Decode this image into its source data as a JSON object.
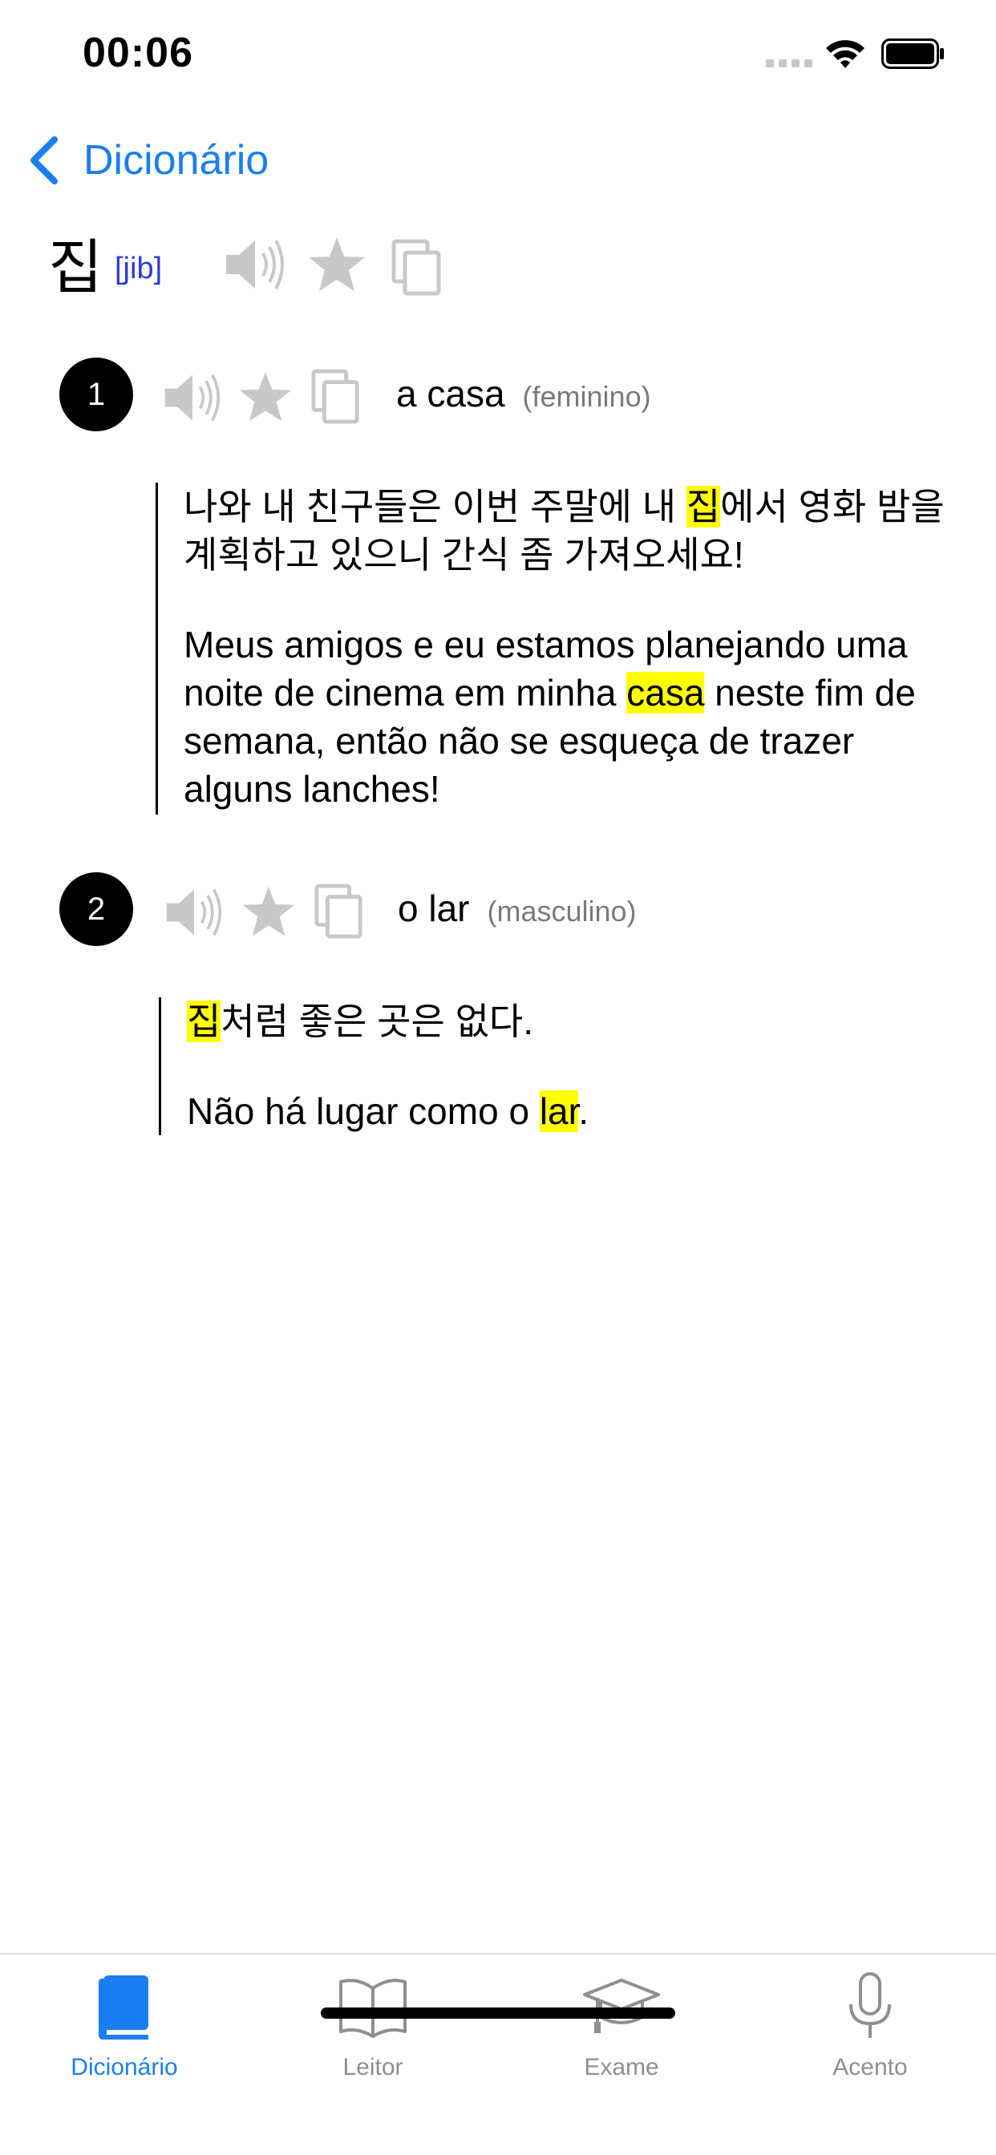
{
  "status_bar": {
    "time": "00:06",
    "wifi_icon": "wifi-icon",
    "battery_icon": "battery-icon"
  },
  "navigation": {
    "back_label": "Dicionário",
    "back_icon": "chevron-left-icon"
  },
  "entry": {
    "headword": "집",
    "romanization": "[jib]",
    "actions": [
      "speaker-icon",
      "star-icon",
      "copy-icon"
    ]
  },
  "senses": [
    {
      "number": "1",
      "translation": "a casa",
      "gender": "(feminino)",
      "example": {
        "korean": {
          "before": "나와 내 친구들은 이번 주말에 내 ",
          "highlight": "집",
          "after": "에서 영화 밤을 계획하고 있으니 간식 좀 가져오세요!"
        },
        "portuguese": {
          "before": "Meus amigos e eu estamos planejando uma noite de cinema em minha ",
          "highlight": "casa",
          "after": " neste fim de semana, então não se esqueça de trazer alguns lanches!"
        }
      }
    },
    {
      "number": "2",
      "translation": "o lar",
      "gender": "(masculino)",
      "example": {
        "korean": {
          "before": "",
          "highlight": "집",
          "after": "처럼 좋은 곳은 없다."
        },
        "portuguese": {
          "before": "Não há lugar como o ",
          "highlight": "lar",
          "after": "."
        }
      }
    }
  ],
  "tab_bar": {
    "tabs": [
      {
        "label": "Dicionário",
        "icon": "book-icon",
        "active": true
      },
      {
        "label": "Leitor",
        "icon": "open-book-icon",
        "active": false
      },
      {
        "label": "Exame",
        "icon": "graduation-cap-icon",
        "active": false
      },
      {
        "label": "Acento",
        "icon": "microphone-icon",
        "active": false
      }
    ]
  },
  "colors": {
    "accent": "#1a7ef2",
    "highlight": "#ffff00",
    "inactive_icon": "#c8c8c8",
    "inactive_tab": "#8e8e93"
  }
}
